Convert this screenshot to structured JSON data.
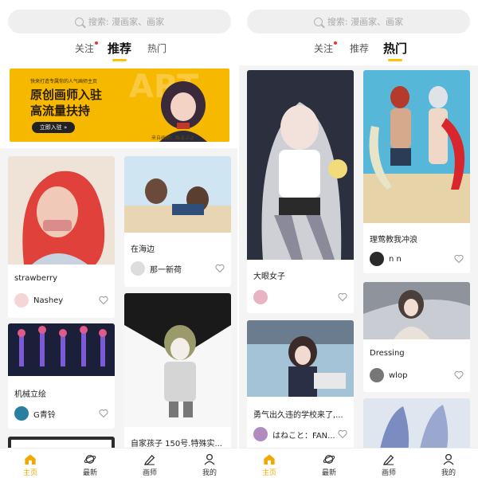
{
  "colors": {
    "accent": "#ffc107",
    "accent_text": "#f2a800",
    "notify_dot": "#e53935",
    "background": "#f4f4f4"
  },
  "search": {
    "placeholder": "搜索: 漫画家、画家"
  },
  "left": {
    "tabs": [
      {
        "label": "关注",
        "has_dot": true
      },
      {
        "label": "推荐",
        "active": true
      },
      {
        "label": "热门"
      }
    ],
    "banner": {
      "small": "快来打造专属你的人气画师主页",
      "line1": "原创画师入驻",
      "line2": "高流量扶持",
      "button": "立即入驻 »",
      "source": "来自画师：ぬるぶよ"
    },
    "cards": [
      {
        "title": "strawberry",
        "user": "Nashey"
      },
      {
        "title": "在海边",
        "user": "那一新荷"
      },
      {
        "title": "机械立绘",
        "user": "G青铃"
      },
      {
        "title": "自家孩子 150号.特殊实...",
        "user": ""
      }
    ]
  },
  "right": {
    "tabs": [
      {
        "label": "关注",
        "has_dot": true
      },
      {
        "label": "推荐"
      },
      {
        "label": "热门",
        "active": true
      }
    ],
    "cards": [
      {
        "title": "大眼女子",
        "user": ""
      },
      {
        "title": "理莺教我冲浪",
        "user": "n n"
      },
      {
        "title": "勇气出久违的学校来了,...",
        "user": "はねこと：FAN..."
      },
      {
        "title": "Dressing",
        "user": "wlop"
      }
    ]
  },
  "nav": [
    {
      "label": "主页",
      "icon": "home-icon",
      "active": true
    },
    {
      "label": "最新",
      "icon": "planet-icon"
    },
    {
      "label": "画师",
      "icon": "pen-icon"
    },
    {
      "label": "我的",
      "icon": "user-icon"
    }
  ]
}
